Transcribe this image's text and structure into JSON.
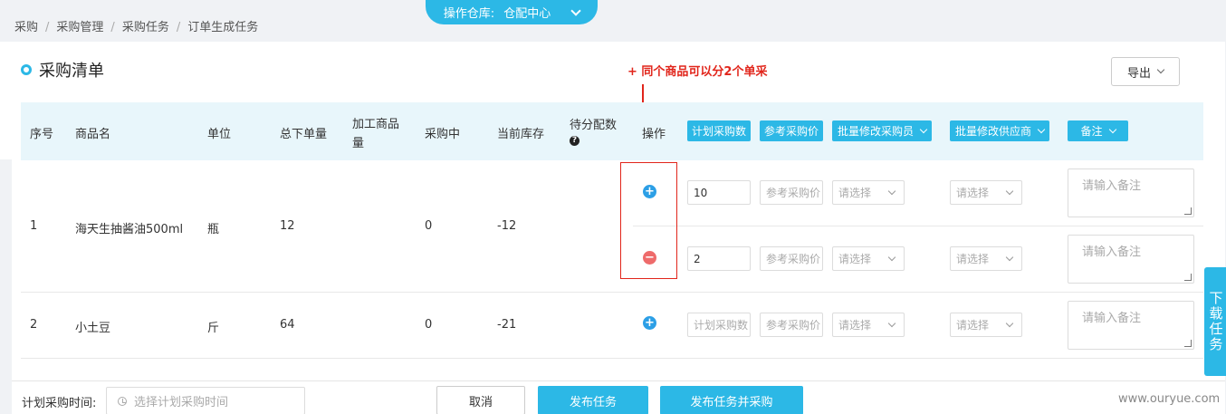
{
  "breadcrumb": {
    "items": [
      "采购",
      "采购管理",
      "采购任务",
      "订单生成任务"
    ],
    "separator": "/"
  },
  "warehouse": {
    "label": "操作仓库:",
    "value": "仓配中心"
  },
  "section": {
    "title": "采购清单",
    "export_label": "导出"
  },
  "annotation": "+ 同个商品可以分2个单采",
  "table": {
    "headers": {
      "index": "序号",
      "product": "商品名",
      "unit": "单位",
      "total_ordered": "总下单量",
      "processed": "加工商品量",
      "purchasing": "采购中",
      "stock": "当前库存",
      "pending": "待分配数",
      "action": "操作",
      "plan_qty": "计划采购数",
      "ref_price": "参考采购价",
      "buyer": "批量修改采购员",
      "supplier": "批量修改供应商",
      "remark": "备注"
    },
    "rows": [
      {
        "index": "1",
        "product": "海天生抽酱油500ml",
        "unit": "瓶",
        "total_ordered": "12",
        "purchasing": "0",
        "stock": "-12",
        "subrows": [
          {
            "plan_qty": "10",
            "icon": "plus"
          },
          {
            "plan_qty": "2",
            "icon": "minus"
          }
        ]
      },
      {
        "index": "2",
        "product": "小土豆",
        "unit": "斤",
        "total_ordered": "64",
        "purchasing": "0",
        "stock": "-21",
        "subrows": [
          {
            "plan_qty": "",
            "icon": "plus"
          }
        ]
      }
    ],
    "placeholders": {
      "plan_qty": "计划采购数",
      "ref_price": "参考采购价",
      "select": "请选择",
      "remark": "请输入备注"
    }
  },
  "footer": {
    "plan_time_label": "计划采购时间:",
    "plan_time_placeholder": "选择计划采购时间",
    "cancel": "取消",
    "publish": "发布任务",
    "publish_and_purchase": "发布任务并采购",
    "watermark": "www.ouryue.com"
  },
  "side_tab": "下载任务",
  "colors": {
    "accent": "#2cb8e6",
    "annotation": "#e1251b",
    "minus": "#ee6b6b",
    "header_bg": "#e8f6fb"
  }
}
